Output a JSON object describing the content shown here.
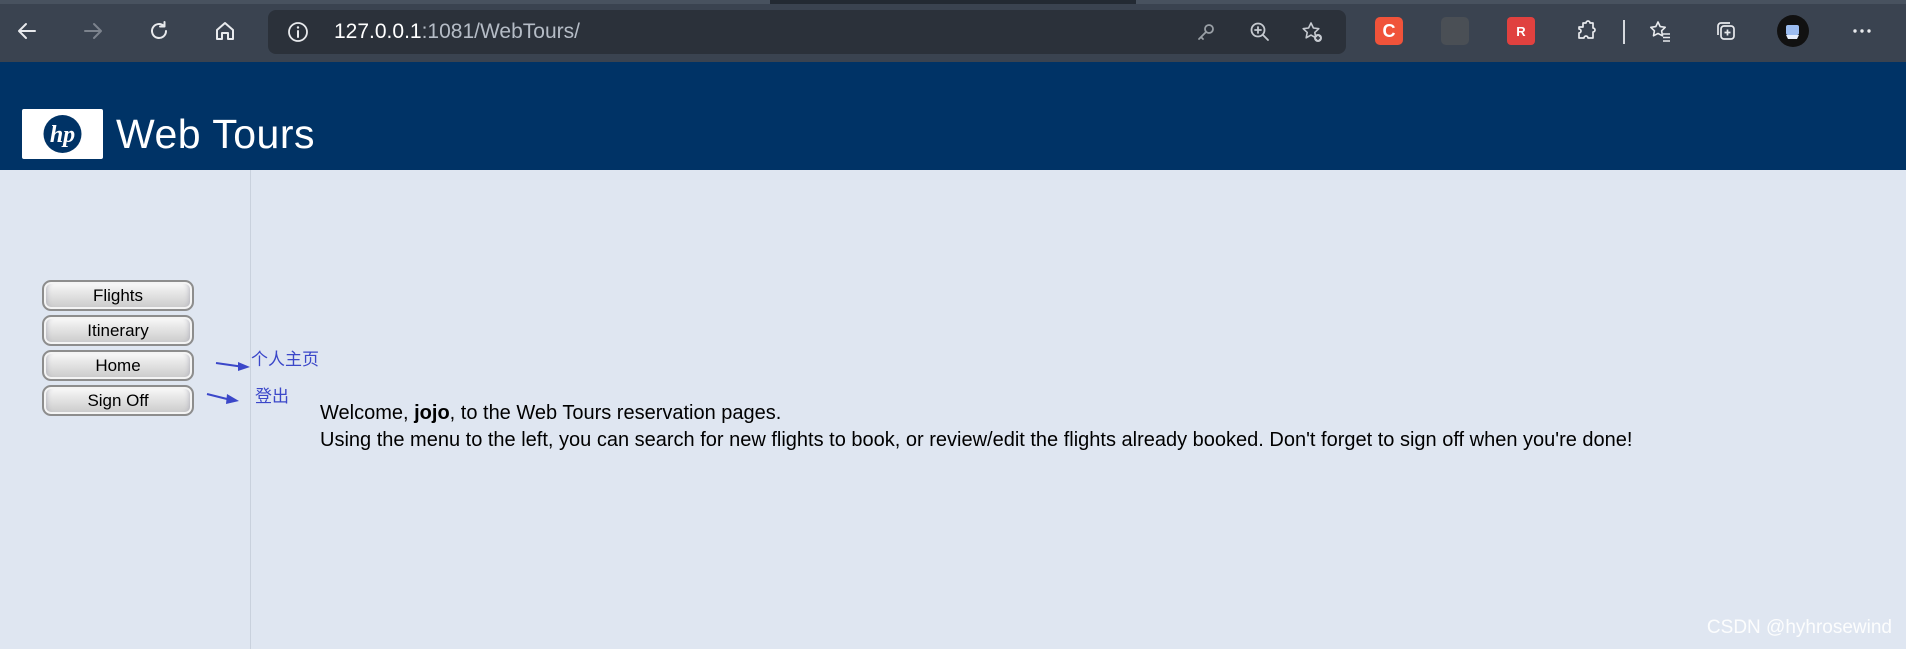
{
  "browser": {
    "url_host": "127.0.0.1",
    "url_rest": ":1081/WebTours/",
    "nav": {
      "back": "back-arrow-icon",
      "forward": "forward-arrow-icon",
      "reload": "reload-icon",
      "home": "home-icon"
    },
    "extensions": [
      {
        "name": "csdn-extension",
        "letter": "C",
        "color": "#f0533a"
      },
      {
        "name": "dark-extension",
        "letter": "",
        "color": "#4a4f55"
      },
      {
        "name": "red-extension",
        "letter": "R",
        "color": "#e0413f"
      }
    ]
  },
  "header": {
    "logo_text": "hp",
    "brand": "Web Tours",
    "banner_color": "#003366"
  },
  "sidebar": {
    "buttons": [
      {
        "label": "Flights"
      },
      {
        "label": "Itinerary"
      },
      {
        "label": "Home"
      },
      {
        "label": "Sign Off"
      }
    ]
  },
  "annotations": {
    "home_note": "个人主页",
    "signoff_note": "登出"
  },
  "main": {
    "welcome_prefix": "Welcome, ",
    "username": "jojo",
    "welcome_suffix": ", to the Web Tours reservation pages.",
    "instructions": "Using the menu to the left, you can search for new flights to book, or review/edit the flights already booked. Don't forget to sign off when you're done!"
  },
  "watermark": "CSDN @hyhrosewind"
}
